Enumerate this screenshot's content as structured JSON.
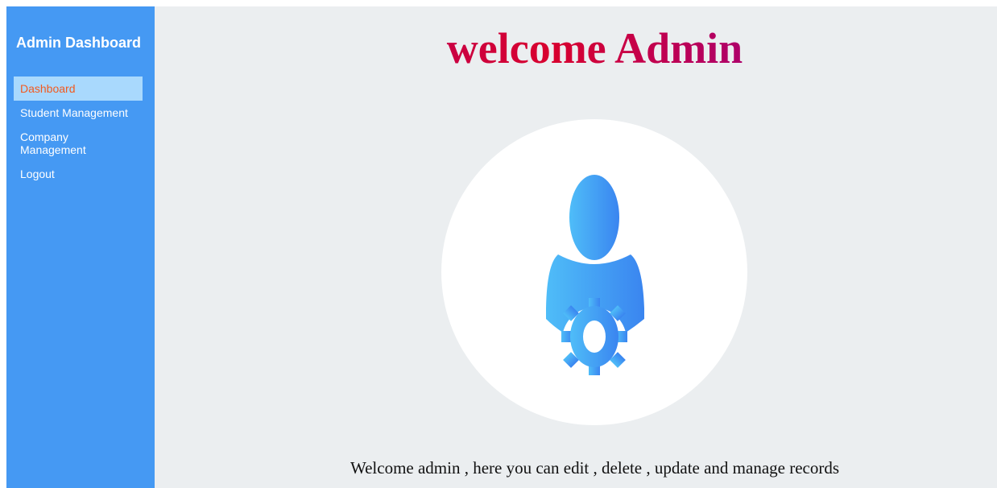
{
  "sidebar": {
    "title": "Admin Dashboard",
    "items": [
      {
        "label": "Dashboard",
        "active": true
      },
      {
        "label": "Student Management",
        "active": false
      },
      {
        "label": "Company Management",
        "active": false
      },
      {
        "label": "Logout",
        "active": false
      }
    ]
  },
  "main": {
    "heading": "welcome Admin",
    "avatar_icon": "admin-user-gear-icon",
    "message": "Welcome admin , here you can edit , delete , update and manage records"
  },
  "colors": {
    "sidebar_bg": "#4599f3",
    "active_item_bg": "#a9d9fd",
    "active_item_text": "#f25a1f",
    "main_bg": "#ebeef0",
    "heading_gradient_start": "#a1007a",
    "heading_gradient_end": "#e0001a",
    "icon_light_blue": "#4fbdf8",
    "icon_dark_blue": "#3a85f0"
  }
}
